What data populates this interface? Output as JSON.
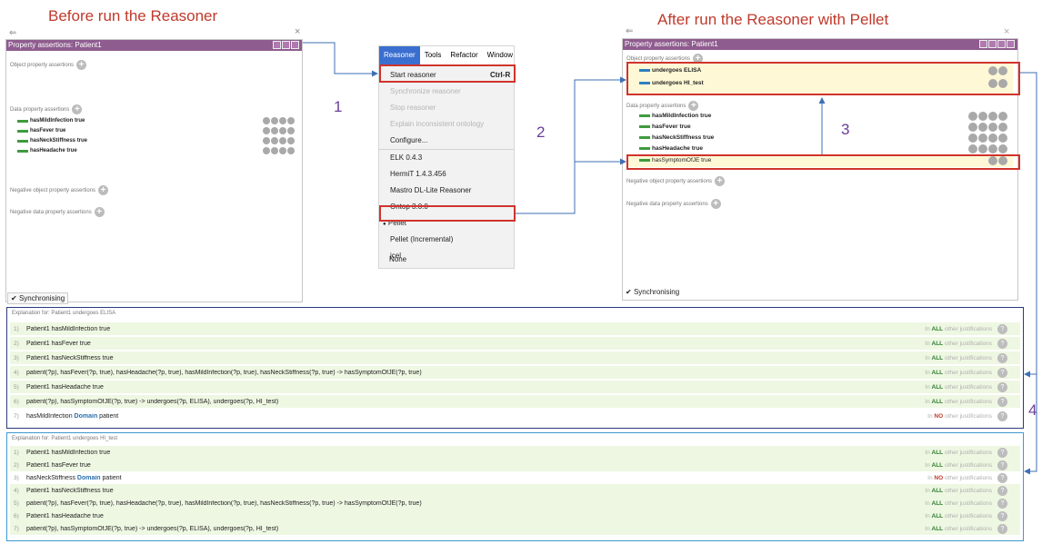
{
  "headings": {
    "before": "Before run the Reasoner",
    "after": "After run the Reasoner with Pellet"
  },
  "step_numbers": [
    "1",
    "2",
    "3",
    "4"
  ],
  "left_panel": {
    "title": "Property assertions: Patient1",
    "object_section": "Object property assertions",
    "data_section": "Data property assertions",
    "data_rows": [
      "hasMildInfection  true",
      "hasFever  true",
      "hasNeckStiffness  true",
      "hasHeadache  true"
    ],
    "neg_object_section": "Negative object property assertions",
    "neg_data_section": "Negative data property assertions",
    "sync": "Synchronising"
  },
  "menu": {
    "bar": [
      "Reasoner",
      "Tools",
      "Refactor",
      "Window"
    ],
    "items": [
      {
        "label": "Start reasoner",
        "shortcut": "Ctrl-R",
        "enabled": true
      },
      {
        "label": "Synchronize reasoner",
        "enabled": false
      },
      {
        "label": "Stop reasoner",
        "enabled": false
      },
      {
        "label": "Explain inconsistent ontology",
        "enabled": false
      },
      {
        "label": "Configure...",
        "enabled": true
      },
      {
        "label": "ELK 0.4.3",
        "enabled": true
      },
      {
        "label": "HermiT 1.4.3.456",
        "enabled": true
      },
      {
        "label": "Mastro DL-Lite Reasoner",
        "enabled": true
      },
      {
        "label": "Ontop 3.0.0",
        "enabled": true
      },
      {
        "label": "Pellet",
        "enabled": true,
        "selected": true
      },
      {
        "label": "Pellet (Incremental)",
        "enabled": true
      },
      {
        "label": "jcel",
        "enabled": true
      },
      {
        "label": "None",
        "enabled": true
      }
    ],
    "bullet": "●"
  },
  "right_panel": {
    "title": "Property assertions: Patient1",
    "object_section": "Object property assertions",
    "object_rows": [
      "undergoes  ELISA",
      "undergoes  HI_test"
    ],
    "data_section": "Data property assertions",
    "data_rows": [
      "hasMildInfection  true",
      "hasFever  true",
      "hasNeckStiffness  true",
      "hasHeadache  true",
      "hasSymptomOfJE  true"
    ],
    "neg_object_section": "Negative object property assertions",
    "neg_data_section": "Negative data property assertions",
    "sync": "Synchronising"
  },
  "explanation1": {
    "title": "Explanation for: Patient1 undergoes ELISA",
    "rows": [
      {
        "idx": "1)",
        "text": "Patient1 hasMildInfection true",
        "just_pre": "In",
        "just_kw": "ALL",
        "just_post": "other justifications"
      },
      {
        "idx": "2)",
        "text": "Patient1 hasFever true",
        "just_pre": "In",
        "just_kw": "ALL",
        "just_post": "other justifications"
      },
      {
        "idx": "3)",
        "text": "Patient1 hasNeckStiffness true",
        "just_pre": "In",
        "just_kw": "ALL",
        "just_post": "other justifications"
      },
      {
        "idx": "4)",
        "text": "patient(?p), hasFever(?p, true), hasHeadache(?p, true), hasMildInfection(?p, true), hasNeckStiffness(?p, true) -> hasSymptomOfJE(?p, true)",
        "just_pre": "In",
        "just_kw": "ALL",
        "just_post": "other justifications"
      },
      {
        "idx": "5)",
        "text": "Patient1 hasHeadache true",
        "just_pre": "In",
        "just_kw": "ALL",
        "just_post": "other justifications"
      },
      {
        "idx": "6)",
        "text": "patient(?p), hasSymptomOfJE(?p, true) -> undergoes(?p, ELISA), undergoes(?p, HI_test)",
        "just_pre": "In",
        "just_kw": "ALL",
        "just_post": "other justifications"
      },
      {
        "idx": "7)",
        "text_a": "hasMildInfection",
        "text_kw": "Domain",
        "text_b": "patient",
        "just_pre": "In",
        "just_kw": "NO",
        "just_post": "other justifications"
      }
    ]
  },
  "explanation2": {
    "title": "Explanation for: Patient1 undergoes HI_test",
    "rows": [
      {
        "idx": "1)",
        "text": "Patient1 hasMildInfection true",
        "just_pre": "In",
        "just_kw": "ALL",
        "just_post": "other justifications"
      },
      {
        "idx": "2)",
        "text": "Patient1 hasFever true",
        "just_pre": "In",
        "just_kw": "ALL",
        "just_post": "other justifications"
      },
      {
        "idx": "3)",
        "text_a": "hasNeckStiffness",
        "text_kw": "Domain",
        "text_b": "patient",
        "just_pre": "In",
        "just_kw": "NO",
        "just_post": "other justifications"
      },
      {
        "idx": "4)",
        "text": "Patient1 hasNeckStiffness true",
        "just_pre": "In",
        "just_kw": "ALL",
        "just_post": "other justifications"
      },
      {
        "idx": "5)",
        "text": "patient(?p), hasFever(?p, true), hasHeadache(?p, true), hasMildInfection(?p, true), hasNeckStiffness(?p, true) -> hasSymptomOfJE(?p, true)",
        "just_pre": "In",
        "just_kw": "ALL",
        "just_post": "other justifications"
      },
      {
        "idx": "6)",
        "text": "Patient1 hasHeadache true",
        "just_pre": "In",
        "just_kw": "ALL",
        "just_post": "other justifications"
      },
      {
        "idx": "7)",
        "text": "patient(?p), hasSymptomOfJE(?p, true) -> undergoes(?p, ELISA), undergoes(?p, HI_test)",
        "just_pre": "In",
        "just_kw": "ALL",
        "just_post": "other justifications"
      }
    ]
  },
  "icons": {
    "close": "×",
    "back": "⇐",
    "plus": "+",
    "question": "?",
    "check": "✔"
  },
  "colors": {
    "heading": "#c0392b",
    "panel_title": "#8f5c8f",
    "highlight_box": "#d0342c",
    "menu_active": "#3a6fcf",
    "explanation_border": "#2b3a7c",
    "explanation2_border": "#3d9ad1",
    "row_green": "#eef7e2"
  }
}
